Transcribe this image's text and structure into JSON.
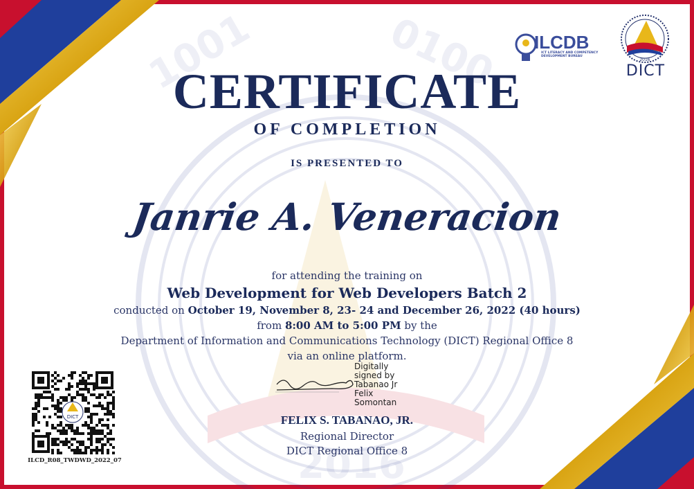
{
  "certificate": {
    "title": "CERTIFICATE",
    "subtitle": "OF COMPLETION",
    "presented_to": "IS PRESENTED TO",
    "recipient": "Janrie A. Veneracion"
  },
  "body": {
    "line1": "for attending the training on",
    "training": "Web Development for Web Developers Batch 2",
    "conducted_prefix": "conducted on ",
    "dates": "October 19, November 8, 23- 24 and December 26, 2022 (40 hours)",
    "from_prefix": "from ",
    "time": "8:00 AM to 5:00 PM",
    "time_suffix": " by the",
    "department": "Department of Information and Communications Technology (DICT) Regional Office 8",
    "platform": "via an online platform."
  },
  "signature": {
    "digital_text": [
      "Digitally",
      "signed by",
      "Tabanao Jr",
      "Felix",
      "Somontan"
    ],
    "name": "FELIX S. TABANAO, JR.",
    "title": "Regional Director",
    "office": "DICT Regional Office 8"
  },
  "qr": {
    "code": "ILCD_R08_TWDWD_2022_07",
    "center_label": "DICT"
  },
  "logos": {
    "ilcdb_text": "ILCDB",
    "ilcdb_small": "ICT LITERACY AND COMPETENCY DEVELOPMENT BUREAU",
    "dict_text": "DICT",
    "dict_year": "2016"
  },
  "watermark": {
    "digits_top": "1001",
    "digits_top_right": "0100",
    "digits_year": "2016"
  },
  "colors": {
    "navy": "#1b2a5a",
    "blue": "#1f3f9c",
    "gold": "#e8b71a",
    "red": "#c8102e"
  }
}
